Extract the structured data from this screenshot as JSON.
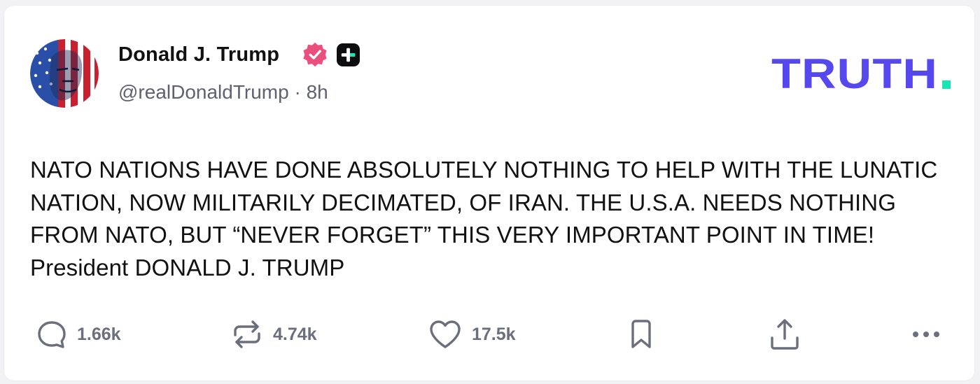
{
  "post": {
    "author": {
      "display_name": "Donald J. Trump",
      "handle": "@realDonaldTrump",
      "separator": "·",
      "age": "8h",
      "avatar_icon": "avatar-image",
      "verified_icon": "verified-badge-icon",
      "badge_icon": "plus-badge-icon"
    },
    "brand": {
      "logo_text": "TRUTH",
      "logo_dot": ".",
      "logo_color": "#5448ee",
      "dot_color": "#17e5b4"
    },
    "body": "NATO NATIONS HAVE DONE ABSOLUTELY NOTHING TO HELP WITH THE LUNATIC NATION, NOW MILITARILY DECIMATED, OF IRAN. THE U.S.A. NEEDS NOTHING FROM NATO, BUT “NEVER FORGET” THIS VERY IMPORTANT POINT IN TIME! President DONALD J. TRUMP",
    "actions": {
      "replies": "1.66k",
      "retruths": "4.74k",
      "likes": "17.5k",
      "bookmark_icon": "bookmark-icon",
      "share_icon": "share-icon",
      "more_icon": "more-icon"
    },
    "colors": {
      "verified": "#ea4f7e",
      "icon_gray": "#6b6e7c",
      "handle_gray": "#5f6170"
    }
  }
}
